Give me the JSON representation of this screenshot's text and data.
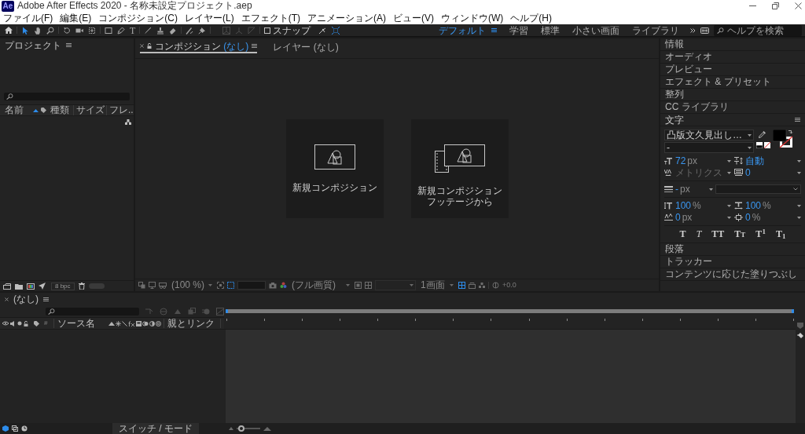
{
  "window": {
    "app_icon": "Ae",
    "title": "Adobe After Effects 2020 - 名称未設定プロジェクト.aep"
  },
  "menu": [
    "ファイル(F)",
    "編集(E)",
    "コンポジション(C)",
    "レイヤー(L)",
    "エフェクト(T)",
    "アニメーション(A)",
    "ビュー(V)",
    "ウィンドウ(W)",
    "ヘルプ(H)"
  ],
  "toolbar": {
    "tool_groups": [
      [
        {
          "kind": "selection",
          "selected": true
        },
        {
          "kind": "hand",
          "selected": false
        },
        {
          "kind": "zoom",
          "selected": false
        }
      ],
      [
        {
          "kind": "rotate",
          "selected": false
        },
        {
          "kind": "camera",
          "selected": false
        },
        {
          "kind": "pan-behind",
          "selected": false
        }
      ],
      [
        {
          "kind": "rectangle",
          "selected": false
        },
        {
          "kind": "pen",
          "selected": false
        },
        {
          "kind": "type",
          "label": "T",
          "selected": false
        }
      ],
      [
        {
          "kind": "brush",
          "selected": false
        },
        {
          "kind": "stamp",
          "selected": false
        },
        {
          "kind": "eraser",
          "selected": false
        }
      ],
      [
        {
          "kind": "roto",
          "selected": false
        },
        {
          "kind": "pin",
          "selected": false
        }
      ]
    ],
    "snap": {
      "label": "スナップ",
      "checked": false
    },
    "workspaces": [
      {
        "label": "デフォルト",
        "selected": true
      },
      {
        "label": "学習",
        "selected": false
      },
      {
        "label": "標準",
        "selected": false
      },
      {
        "label": "小さい画面",
        "selected": false
      },
      {
        "label": "ライブラリ",
        "selected": false
      }
    ],
    "help_search": {
      "placeholder": "ヘルプを検索"
    }
  },
  "project": {
    "title": "プロジェクト",
    "columns": [
      {
        "label": "名前",
        "sorted": true
      },
      {
        "label": "種類",
        "sorted": false
      },
      {
        "label": "サイズ",
        "sorted": false
      },
      {
        "label": "フレ..",
        "sorted": false
      }
    ],
    "bit_depth": "8 bpc"
  },
  "composition": {
    "tabs": [
      {
        "label": "コンポジション",
        "target": "(なし)",
        "selected": true
      },
      {
        "label": "レイヤー",
        "target": "(なし)",
        "selected": false
      }
    ],
    "cards": [
      {
        "kind": "blank",
        "label": "新規コンポジション"
      },
      {
        "kind": "footage",
        "label": "新規コンポジションフッテージから"
      }
    ],
    "viewer_bar": {
      "magnification": "(100 %)",
      "resolution": "(フル画質)",
      "view_layout": "1画面",
      "exposure": "+0.0"
    }
  },
  "panels": [
    {
      "label": "情報",
      "expanded": false
    },
    {
      "label": "オーディオ",
      "expanded": false
    },
    {
      "label": "プレビュー",
      "expanded": false
    },
    {
      "label": "エフェクト & プリセット",
      "expanded": false
    },
    {
      "label": "整列",
      "expanded": false
    },
    {
      "label": "CC ライブラリ",
      "expanded": false
    },
    {
      "label": "文字",
      "expanded": true
    },
    {
      "label": "段落",
      "expanded": false
    },
    {
      "label": "トラッカー",
      "expanded": false
    },
    {
      "label": "コンテンツに応じた塗りつぶし",
      "expanded": false
    }
  ],
  "character": {
    "font": "凸版文久見出し…",
    "style": "-",
    "fields": [
      {
        "kind": "size",
        "value": "72",
        "unit": "px",
        "disabled": false
      },
      {
        "kind": "leading",
        "value": "自動",
        "disabled": false
      },
      {
        "kind": "kerning",
        "value": "メトリクス",
        "disabled": true
      },
      {
        "kind": "tracking",
        "value": "0",
        "disabled": false
      }
    ],
    "stroke_width": {
      "value": "-",
      "unit": "px"
    },
    "scale_fields": [
      {
        "kind": "v-scale",
        "value": "100",
        "unit": "%",
        "disabled": false
      },
      {
        "kind": "h-scale",
        "value": "100",
        "unit": "%",
        "disabled": false
      },
      {
        "kind": "baseline",
        "value": "0",
        "unit": "px",
        "disabled": false
      },
      {
        "kind": "tsume",
        "value": "0",
        "unit": "%",
        "disabled": false
      }
    ],
    "styles": [
      {
        "kind": "bold",
        "label": "T"
      },
      {
        "kind": "italic",
        "label": "T"
      },
      {
        "kind": "caps",
        "label": "TT"
      },
      {
        "kind": "smallcaps",
        "label": "TT"
      },
      {
        "kind": "super",
        "label": "T$^{1}$"
      },
      {
        "kind": "sub",
        "label": "T$_{1}$"
      }
    ]
  },
  "timeline": {
    "tab": "(なし)",
    "columns": {
      "number": "#",
      "source": "ソース名",
      "parent": "親とリンク"
    },
    "switch_mode": "スイッチ / モード",
    "zoom_slider": {
      "level": 0.2
    }
  }
}
